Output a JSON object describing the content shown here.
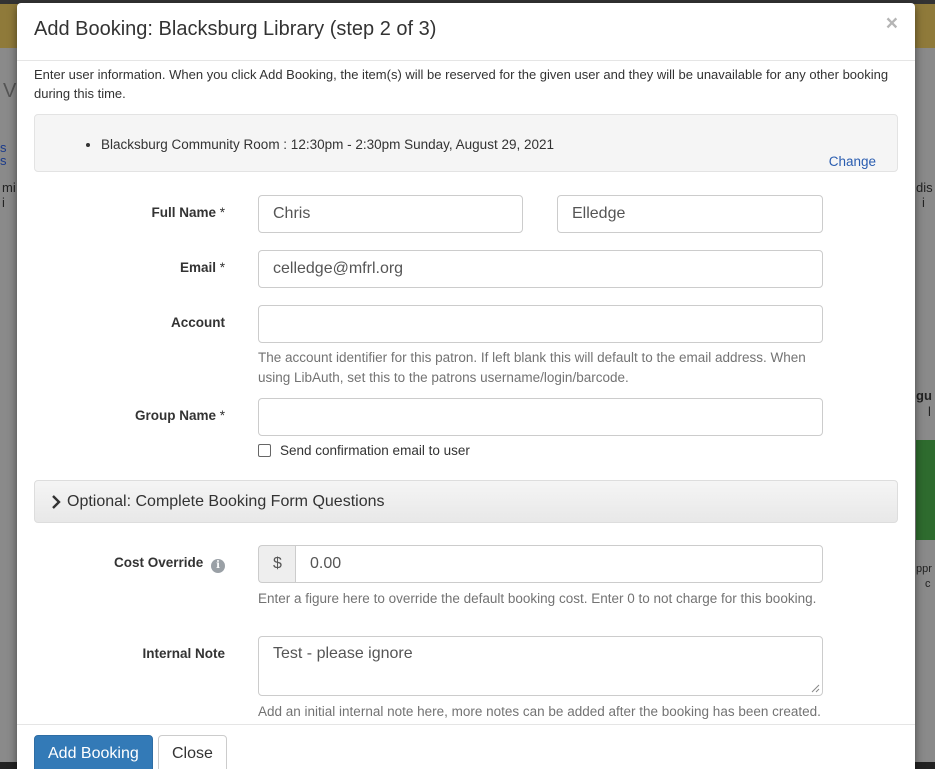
{
  "background": {
    "fragments": [
      "s",
      "s",
      "mi",
      "i",
      "V",
      "dis",
      "i",
      "gu",
      "l",
      "ppr",
      "c"
    ]
  },
  "modal": {
    "title": "Add Booking: Blacksburg Library (step 2 of 3)",
    "close_glyph": "×",
    "intro": "Enter user information. When you click Add Booking, the item(s) will be reserved for the given user and they will be unavailable for any other booking during this time.",
    "booking_items": [
      "Blacksburg Community Room : 12:30pm - 2:30pm Sunday, August 29, 2021"
    ],
    "change_label": "Change"
  },
  "form": {
    "full_name": {
      "label": "Full Name",
      "required_mark": "*",
      "first": "Chris",
      "last": "Elledge"
    },
    "email": {
      "label": "Email",
      "required_mark": "*",
      "value": "celledge@mfrl.org"
    },
    "account": {
      "label": "Account",
      "value": "",
      "help": "The account identifier for this patron. If left blank this will default to the email address. When using LibAuth, set this to the patrons username/login/barcode."
    },
    "group_name": {
      "label": "Group Name",
      "required_mark": "*",
      "value": ""
    },
    "send_confirmation": {
      "label": "Send confirmation email to user",
      "checked": false
    },
    "optional_section": {
      "label": "Optional: Complete Booking Form Questions"
    },
    "cost_override": {
      "label": "Cost Override",
      "info_glyph": "i",
      "currency": "$",
      "value": "0.00",
      "help": "Enter a figure here to override the default booking cost. Enter 0 to not charge for this booking."
    },
    "internal_note": {
      "label": "Internal Note",
      "value": "Test - please ignore",
      "help": "Add an initial internal note here, more notes can be added after the booking has been created."
    }
  },
  "footer": {
    "add_booking_label": "Add Booking",
    "close_label": "Close"
  },
  "colors": {
    "primary": "#337ab7",
    "link": "#2a5db0",
    "help_text": "#737373"
  }
}
